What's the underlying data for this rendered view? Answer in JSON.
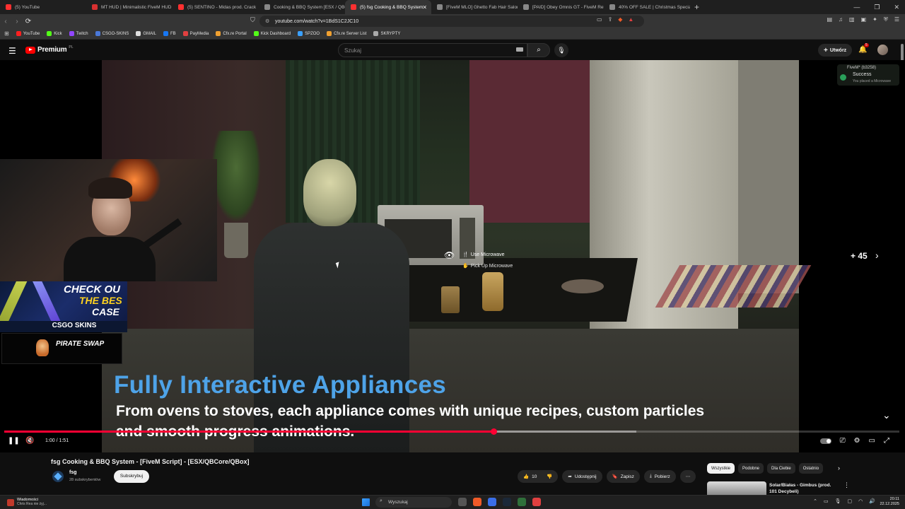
{
  "browser": {
    "tabs": [
      {
        "title": "(5) YouTube",
        "color": "#ff3030"
      },
      {
        "title": "MT HUD | Minimalistic FiveM HUD |",
        "color": "#d83030"
      },
      {
        "title": "(5) SENTINO - Midas prod. Crack",
        "color": "#ff3030"
      },
      {
        "title": "Cooking & BBQ System [ESX / QBCo",
        "color": "#888888"
      },
      {
        "title": "(5) fsg Cooking & BBQ System -",
        "color": "#ff3030",
        "active": true
      },
      {
        "title": "[FiveM MLO] Ghetto Fab Hair Salon |",
        "color": "#888888"
      },
      {
        "title": "[PAID] Obey Omnis GT - FiveM Relea",
        "color": "#888888"
      },
      {
        "title": "40% OFF SALE | Christmas Special Ve",
        "color": "#888888"
      }
    ],
    "url": "youtube.com/watch?v=1BdS1C2JC10",
    "bookmarks": [
      {
        "label": "YouTube",
        "color": "#ff2020"
      },
      {
        "label": "Kick",
        "color": "#53fc18"
      },
      {
        "label": "Twitch",
        "color": "#9146ff"
      },
      {
        "label": "CSGO-SKINS",
        "color": "#4a78d8"
      },
      {
        "label": "GMAIL",
        "color": "#dddddd"
      },
      {
        "label": "FB",
        "color": "#1877f2"
      },
      {
        "label": "PayMedia",
        "color": "#e04040"
      },
      {
        "label": "Cfx.re Portal",
        "color": "#f0a030"
      },
      {
        "label": "Kick Dashboard",
        "color": "#53fc18"
      },
      {
        "label": "SPZOO",
        "color": "#3aa0ff"
      },
      {
        "label": "Cfx.re Server List",
        "color": "#f0a030"
      },
      {
        "label": "SKRYPTY",
        "color": "#aaaaaa"
      }
    ]
  },
  "youtube": {
    "logo": "Premium",
    "logo_region": "PL",
    "search_placeholder": "Szukaj",
    "create_label": "Utwórz",
    "notifications_count": "5"
  },
  "video": {
    "interaction_options": [
      "Use Microwave",
      "Pick Up Microwave"
    ],
    "notification": {
      "title": "FiveM* (b3258)",
      "status": "Success",
      "detail": "You placed a Microwave"
    },
    "ads": {
      "case_l1": "CHECK OU",
      "case_l2": "THE BES",
      "case_l3": "CASE",
      "csgo": "CSGO SKINS",
      "pirate": "PIRATE SWAP"
    },
    "skip_label": "+ 45",
    "caption_title": "Fully Interactive Appliances",
    "caption_line1": "From ovens to stoves, each appliance comes with unique recipes, custom particles",
    "caption_line2": "and smooth progress animations.",
    "time": "1:00 / 1:51",
    "progress": 0.547,
    "buffered": 0.706
  },
  "meta": {
    "title": "fsg Cooking & BBQ System - [FiveM Script] - [ESX/QBCore/QBox]",
    "channel": "fsg",
    "subscribers": "28 subskrybentów",
    "subscribe_label": "Subskrybuj",
    "likes": "10",
    "share": "Udostępnij",
    "save": "Zapisz",
    "download": "Pobierz",
    "chips": [
      "Wszystkie",
      "Podobne",
      "Dla Ciebie",
      "Ostatnio"
    ],
    "rec_title": "Solar/Białas - Gimbus (prod. 101 Decybeli)"
  },
  "taskbar": {
    "news_title": "Wiadomości",
    "news_sub": "Chris Rea nie żyj...",
    "search": "Wyszukaj",
    "time": "20:11",
    "date": "22.12.2025"
  }
}
